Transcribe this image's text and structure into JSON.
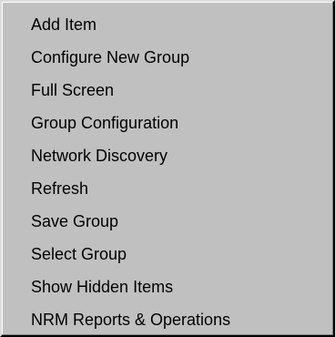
{
  "context_menu": {
    "items": [
      {
        "label": "Add Item"
      },
      {
        "label": "Configure New Group"
      },
      {
        "label": "Full Screen"
      },
      {
        "label": "Group Configuration"
      },
      {
        "label": "Network Discovery"
      },
      {
        "label": "Refresh"
      },
      {
        "label": "Save Group"
      },
      {
        "label": "Select Group"
      },
      {
        "label": "Show Hidden Items"
      },
      {
        "label": "NRM Reports & Operations"
      }
    ]
  },
  "colors": {
    "menu_background": "#c0c0c0",
    "text": "#000000"
  }
}
